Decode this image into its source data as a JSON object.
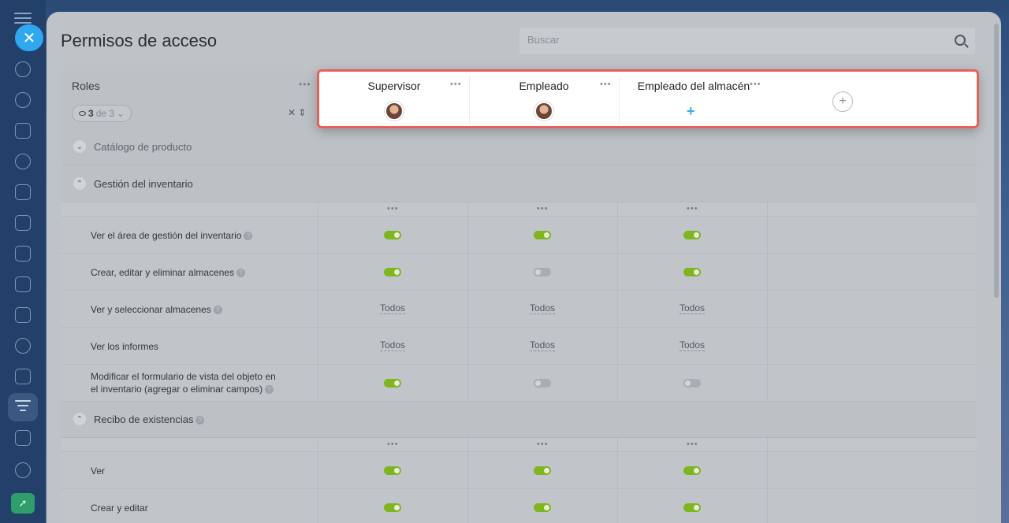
{
  "dialog": {
    "title": "Permisos de acceso",
    "search_placeholder": "Buscar"
  },
  "roles_header": {
    "title": "Roles",
    "count_current": "3",
    "count_total": "de 3"
  },
  "roles": [
    {
      "name": "Supervisor",
      "has_avatar": true
    },
    {
      "name": "Empleado",
      "has_avatar": true
    },
    {
      "name": "Empleado del almacén",
      "has_avatar": false
    }
  ],
  "sections": {
    "catalog": {
      "label": "Catálogo de producto",
      "expanded": false
    },
    "inventory": {
      "label": "Gestión del inventario",
      "expanded": true
    },
    "receipt": {
      "label": "Recibo de existencias",
      "expanded": true
    }
  },
  "inventory_rows": [
    {
      "label": "Ver el área de gestión del inventario",
      "values": [
        "on",
        "on",
        "on"
      ]
    },
    {
      "label": "Crear, editar y eliminar almacenes",
      "values": [
        "on",
        "off",
        "on"
      ]
    },
    {
      "label": "Ver y seleccionar almacenes",
      "values": [
        "Todos",
        "Todos",
        "Todos"
      ]
    },
    {
      "label": "Ver los informes",
      "values": [
        "Todos",
        "Todos",
        "Todos"
      ]
    },
    {
      "label_line1": "Modificar el formulario de vista del objeto en",
      "label_line2": "el inventario (agregar o eliminar campos)",
      "values": [
        "on",
        "off",
        "off"
      ]
    }
  ],
  "receipt_rows": [
    {
      "label": "Ver",
      "values": [
        "on",
        "on",
        "on"
      ]
    },
    {
      "label": "Crear y editar",
      "values": [
        "on",
        "on",
        "on"
      ]
    }
  ],
  "colors": {
    "accent": "#2fa8f0",
    "toggle_on": "#7fb51f",
    "highlight_border": "#e5625a"
  }
}
